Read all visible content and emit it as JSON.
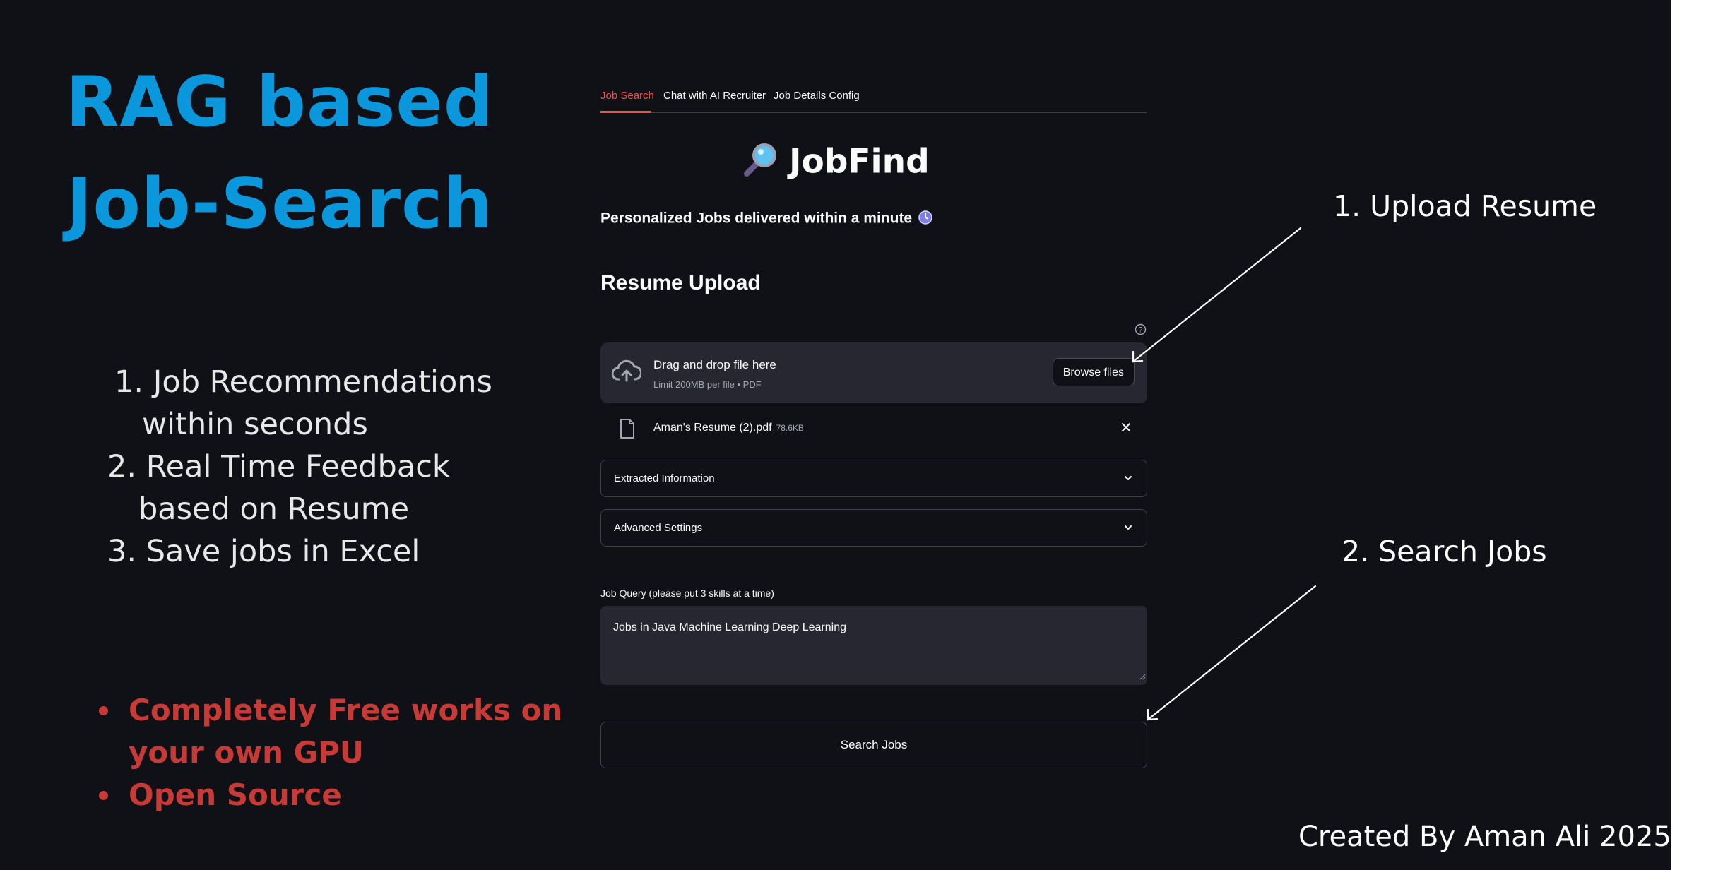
{
  "promo": {
    "headline_line1": "RAG based",
    "headline_line2": "Job-Search",
    "features": [
      {
        "num": "1.",
        "line1": "Job Recommendations",
        "line2": "within seconds"
      },
      {
        "num": "2.",
        "line1": "Real Time Feedback",
        "line2": "based on Resume"
      },
      {
        "num": "3.",
        "line1": "Save jobs in Excel"
      }
    ],
    "bullets": [
      {
        "line1": "Completely Free works on",
        "line2": "your own GPU"
      },
      {
        "line1": "Open Source"
      }
    ],
    "colors": {
      "headline": "#0b97dc",
      "bullets": "#c83a35",
      "background": "#0f1117"
    }
  },
  "tabs": [
    {
      "label": "Job Search",
      "active": true
    },
    {
      "label": "Chat with AI Recruiter",
      "active": false
    },
    {
      "label": "Job Details Config",
      "active": false
    }
  ],
  "app": {
    "title": "JobFind",
    "title_icon": "magnifying-glass-icon",
    "tagline": "Personalized Jobs delivered within a minute",
    "tagline_icon": "stopwatch-icon",
    "section_heading": "Resume Upload",
    "uploader": {
      "title": "Drag and drop file here",
      "subtitle": "Limit 200MB per file • PDF",
      "browse_label": "Browse files"
    },
    "uploaded_file": {
      "name": "Aman's Resume (2).pdf",
      "size": "78.6KB"
    },
    "expanders": [
      "Extracted Information",
      "Advanced Settings"
    ],
    "query": {
      "label": "Job Query (please put 3 skills at a time)",
      "value": "Jobs in Java Machine Learning Deep Learning"
    },
    "search_button": "Search Jobs",
    "accent_color": "#ff4b4b"
  },
  "annotations": {
    "upload": "1. Upload Resume",
    "search": "2. Search Jobs"
  },
  "credit": "Created By Aman Ali 2025"
}
